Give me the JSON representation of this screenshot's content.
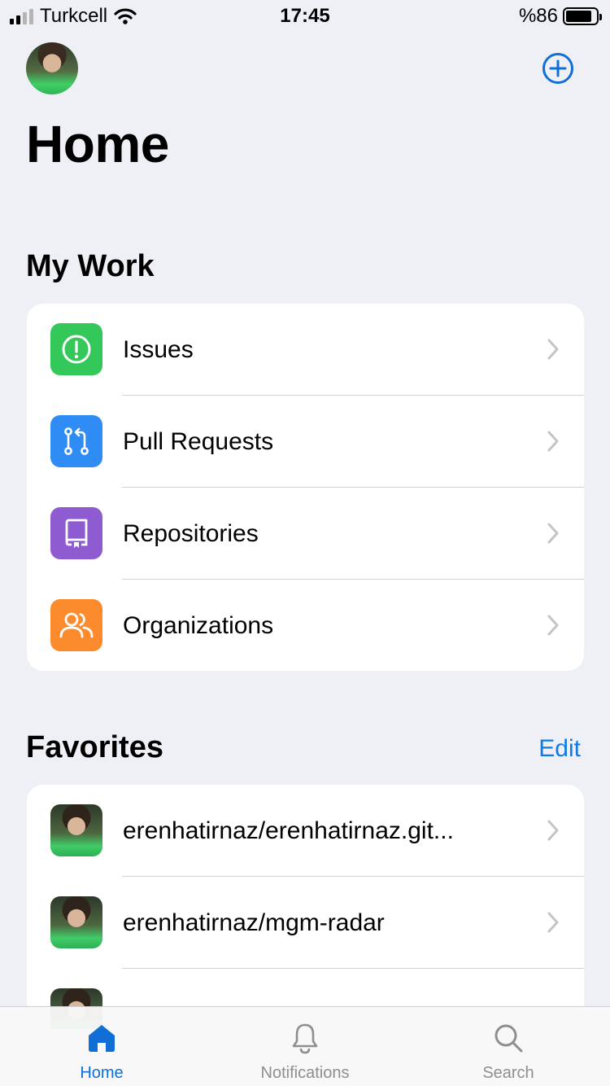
{
  "status_bar": {
    "carrier": "Turkcell",
    "time": "17:45",
    "battery": "%86"
  },
  "header": {
    "title": "Home"
  },
  "my_work": {
    "title": "My Work",
    "items": [
      {
        "label": "Issues",
        "icon": "issue-icon",
        "color": "#34c759"
      },
      {
        "label": "Pull Requests",
        "icon": "pull-request-icon",
        "color": "#2f8cf5"
      },
      {
        "label": "Repositories",
        "icon": "repo-icon",
        "color": "#8e5bd0"
      },
      {
        "label": "Organizations",
        "icon": "organizations-icon",
        "color": "#fb8b2c"
      }
    ]
  },
  "favorites": {
    "title": "Favorites",
    "edit_label": "Edit",
    "items": [
      {
        "label": "erenhatirnaz/erenhatirnaz.git..."
      },
      {
        "label": "erenhatirnaz/mgm-radar"
      }
    ]
  },
  "tab_bar": {
    "tabs": [
      {
        "label": "Home",
        "icon": "home-icon",
        "active": true
      },
      {
        "label": "Notifications",
        "icon": "bell-icon",
        "active": false
      },
      {
        "label": "Search",
        "icon": "search-icon",
        "active": false
      }
    ]
  },
  "colors": {
    "accent": "#0f7ae5",
    "background": "#eff0f5"
  }
}
